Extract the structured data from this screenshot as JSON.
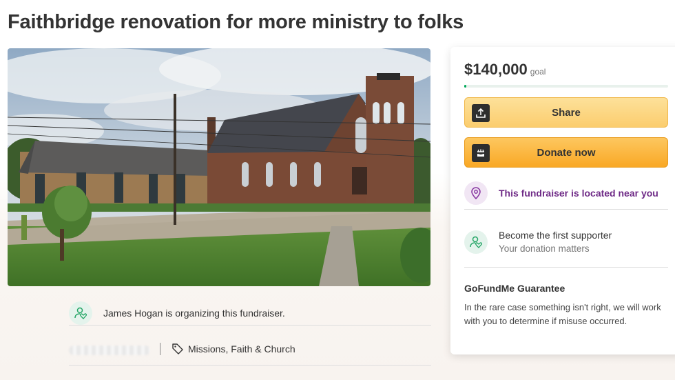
{
  "page": {
    "title": "Faithbridge renovation for more ministry to folks"
  },
  "hero": {
    "alt": "Brick church building with bell tower and adjacent low building, lawn and paved path"
  },
  "organizer": {
    "text": "James Hogan is organizing this fundraiser.",
    "icon": "person-heart-icon"
  },
  "meta": {
    "category": "Missions, Faith & Church",
    "category_icon": "tag-icon"
  },
  "card": {
    "goal_amount": "$140,000",
    "goal_word": "goal",
    "progress_fraction": 0.01,
    "share_label": "Share",
    "share_icon": "share-upload-icon",
    "donate_label": "Donate now",
    "donate_icon": "gofundme-hand-icon",
    "near_text": "This fundraiser is located near you",
    "near_icon": "location-pin-icon",
    "supporter_title": "Become the first supporter",
    "supporter_sub": "Your donation matters",
    "guarantee_title": "GoFundMe Guarantee",
    "guarantee_body": "In the rare case something isn't right, we will work with you to determine if misuse occurred."
  },
  "colors": {
    "accent_green": "#02a95c",
    "share_yellow": "#fbcd6e",
    "donate_orange": "#f9a825",
    "near_purple": "#6e2a86"
  }
}
